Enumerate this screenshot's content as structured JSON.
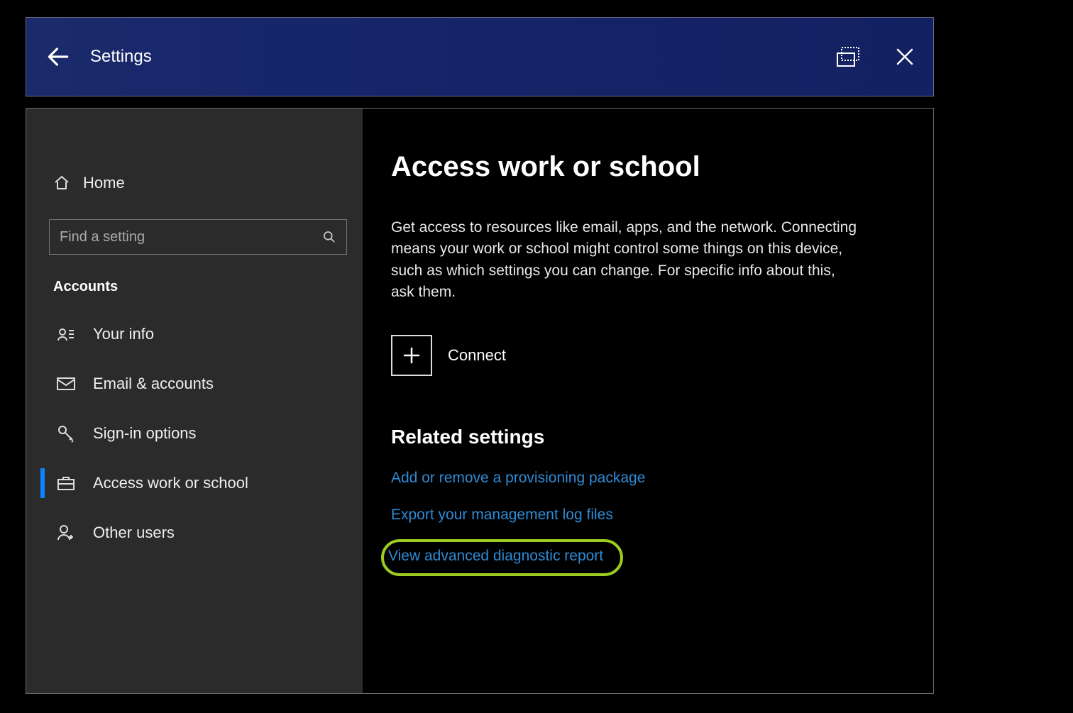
{
  "titlebar": {
    "title": "Settings"
  },
  "sidebar": {
    "home_label": "Home",
    "search_placeholder": "Find a setting",
    "section_label": "Accounts",
    "items": [
      {
        "label": "Your info"
      },
      {
        "label": "Email & accounts"
      },
      {
        "label": "Sign-in options"
      },
      {
        "label": "Access work or school"
      },
      {
        "label": "Other users"
      }
    ]
  },
  "main": {
    "title": "Access work or school",
    "description": "Get access to resources like email, apps, and the network. Connecting means your work or school might control some things on this device, such as which settings you can change. For specific info about this, ask them.",
    "connect_label": "Connect",
    "related_title": "Related settings",
    "links": [
      {
        "label": "Add or remove a provisioning package"
      },
      {
        "label": "Export your management log files"
      },
      {
        "label": "View advanced diagnostic report"
      }
    ]
  },
  "colors": {
    "accent": "#0a84ff",
    "link": "#2e8bd6",
    "highlight": "#9ccc1f",
    "titlebar_bg": "#16266a"
  }
}
